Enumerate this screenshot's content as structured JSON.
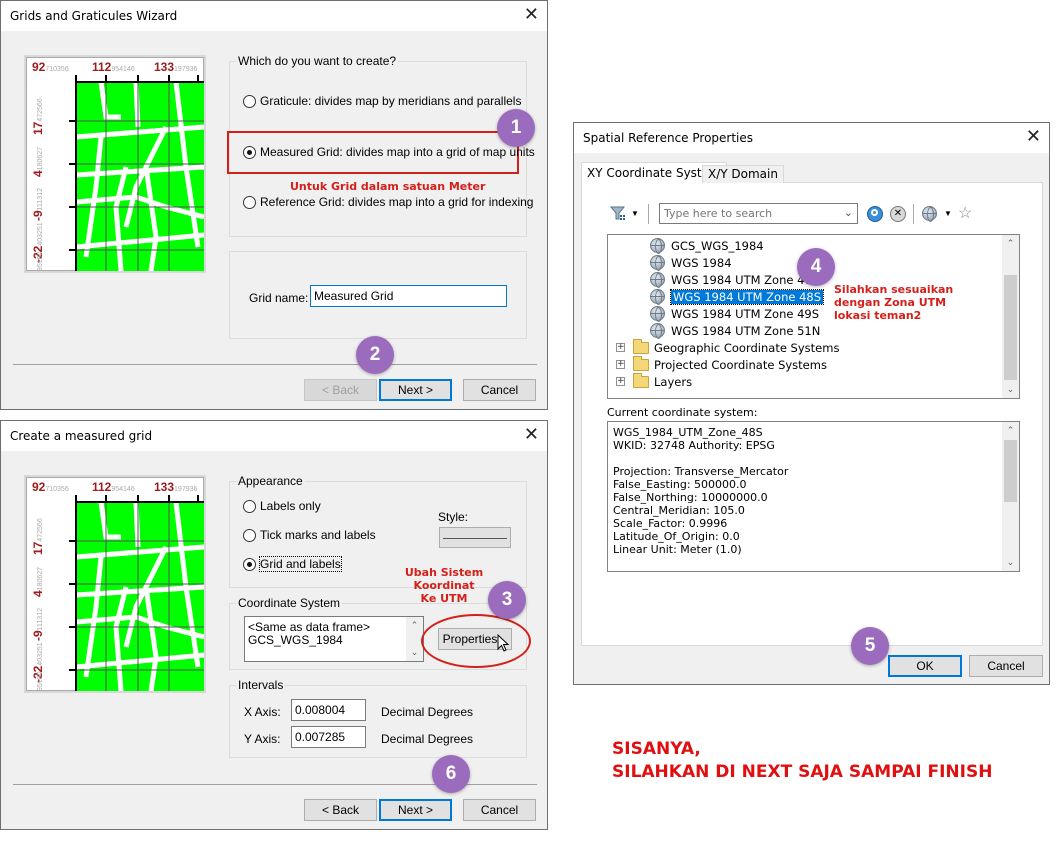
{
  "map_preview": {
    "top_ticks": [
      {
        "big": "92",
        "small": "710356"
      },
      {
        "big": "112",
        "small": "954146"
      },
      {
        "big": "133",
        "small": "197936"
      }
    ],
    "left_ticks": [
      {
        "big": "17",
        "small": "472566"
      },
      {
        "big": "4",
        "small": "180627"
      },
      {
        "big": "-9",
        "small": "111312"
      },
      {
        "big": "-22",
        "small": "403251"
      },
      {
        "big": "",
        "small": "95190"
      }
    ],
    "fill_color": "#00ff00"
  },
  "wizard": {
    "title": "Grids and Graticules Wizard",
    "group_label": "Which do you want to create?",
    "options": [
      {
        "label": "Graticule: divides map by meridians and parallels",
        "checked": false
      },
      {
        "label": "Measured Grid: divides map into a grid of map units",
        "checked": true
      },
      {
        "label": "Reference Grid: divides map into a grid for indexing",
        "checked": false
      }
    ],
    "grid_name_label": "Grid name:",
    "grid_name_value": "Measured Grid",
    "back_label": "< Back",
    "next_label": "Next >",
    "cancel_label": "Cancel"
  },
  "measured": {
    "title": "Create a measured grid",
    "appearance_label": "Appearance",
    "appearance_options": [
      {
        "label": "Labels only",
        "checked": false
      },
      {
        "label": "Tick marks and labels",
        "checked": false
      },
      {
        "label": "Grid and labels",
        "checked": true
      }
    ],
    "style_label": "Style:",
    "coord_group_label": "Coordinate System",
    "coord_text_line1": "<Same as data frame>",
    "coord_text_line2": "GCS_WGS_1984",
    "properties_label": "Properties...",
    "intervals_label": "Intervals",
    "x_axis_label": "X Axis:",
    "x_axis_value": "0.008004",
    "x_axis_unit": "Decimal Degrees",
    "y_axis_label": "Y Axis:",
    "y_axis_value": "0.007285",
    "y_axis_unit": "Decimal Degrees",
    "back_label": "< Back",
    "next_label": "Next >",
    "cancel_label": "Cancel"
  },
  "spatial": {
    "title": "Spatial Reference Properties",
    "tabs": [
      "XY Coordinate System",
      "X/Y Domain"
    ],
    "search_placeholder": "Type here to search",
    "tree": [
      {
        "label": "GCS_WGS_1984",
        "type": "globe",
        "selected": false
      },
      {
        "label": "WGS 1984",
        "type": "globe",
        "selected": false
      },
      {
        "label": "WGS 1984 UTM Zone 47N",
        "type": "globe",
        "selected": false
      },
      {
        "label": "WGS 1984 UTM Zone 48S",
        "type": "globe",
        "selected": true
      },
      {
        "label": "WGS 1984 UTM Zone 49S",
        "type": "globe",
        "selected": false
      },
      {
        "label": "WGS 1984 UTM Zone 51N",
        "type": "globe",
        "selected": false
      },
      {
        "label": "Geographic Coordinate Systems",
        "type": "folder",
        "selected": false
      },
      {
        "label": "Projected Coordinate Systems",
        "type": "folder",
        "selected": false
      },
      {
        "label": "Layers",
        "type": "folder",
        "selected": false
      }
    ],
    "current_label": "Current coordinate system:",
    "current_lines": [
      "WGS_1984_UTM_Zone_48S",
      "WKID: 32748 Authority: EPSG",
      "",
      "Projection: Transverse_Mercator",
      "False_Easting: 500000.0",
      "False_Northing: 10000000.0",
      "Central_Meridian: 105.0",
      "Scale_Factor: 0.9996",
      "Latitude_Of_Origin: 0.0",
      "Linear Unit: Meter (1.0)"
    ],
    "ok_label": "OK",
    "cancel_label": "Cancel"
  },
  "annotations": {
    "badges": [
      "1",
      "2",
      "3",
      "4",
      "5",
      "6"
    ],
    "note_meter": "Untuk Grid dalam satuan Meter",
    "note_utm_line1": "Ubah Sistem Koordinat",
    "note_utm_line2": "Ke UTM",
    "note_zone_line1": "Silahkan sesuaikan",
    "note_zone_line2": "dengan Zona UTM",
    "note_zone_line3": "lokasi teman2",
    "footer_line1": "SISANYA,",
    "footer_line2": "SILAHKAN DI NEXT SAJA SAMPAI FINISH",
    "accent_color": "#9b6bbd",
    "note_color": "#d4201a"
  }
}
